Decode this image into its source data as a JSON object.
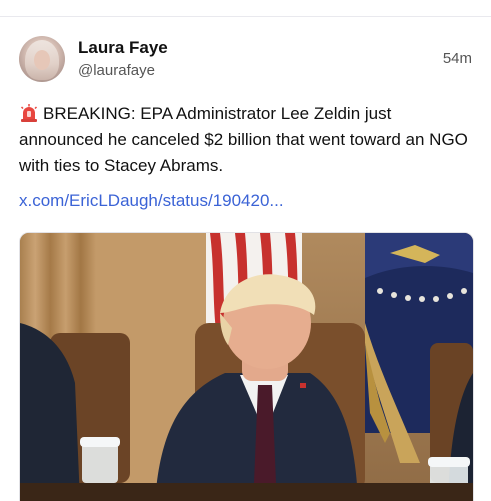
{
  "post": {
    "author_name": "Laura Faye",
    "author_handle": "@laurafaye",
    "timestamp": "54m",
    "text": "BREAKING: EPA Administrator Lee Zeldin just announced he canceled $2 billion that went toward an NGO with ties to Stacey Abrams.",
    "link": "x.com/EricLDaugh/status/190420...",
    "leading_icon": "rotating-light-icon"
  },
  "media": {
    "description_icon": "photo-icon"
  }
}
